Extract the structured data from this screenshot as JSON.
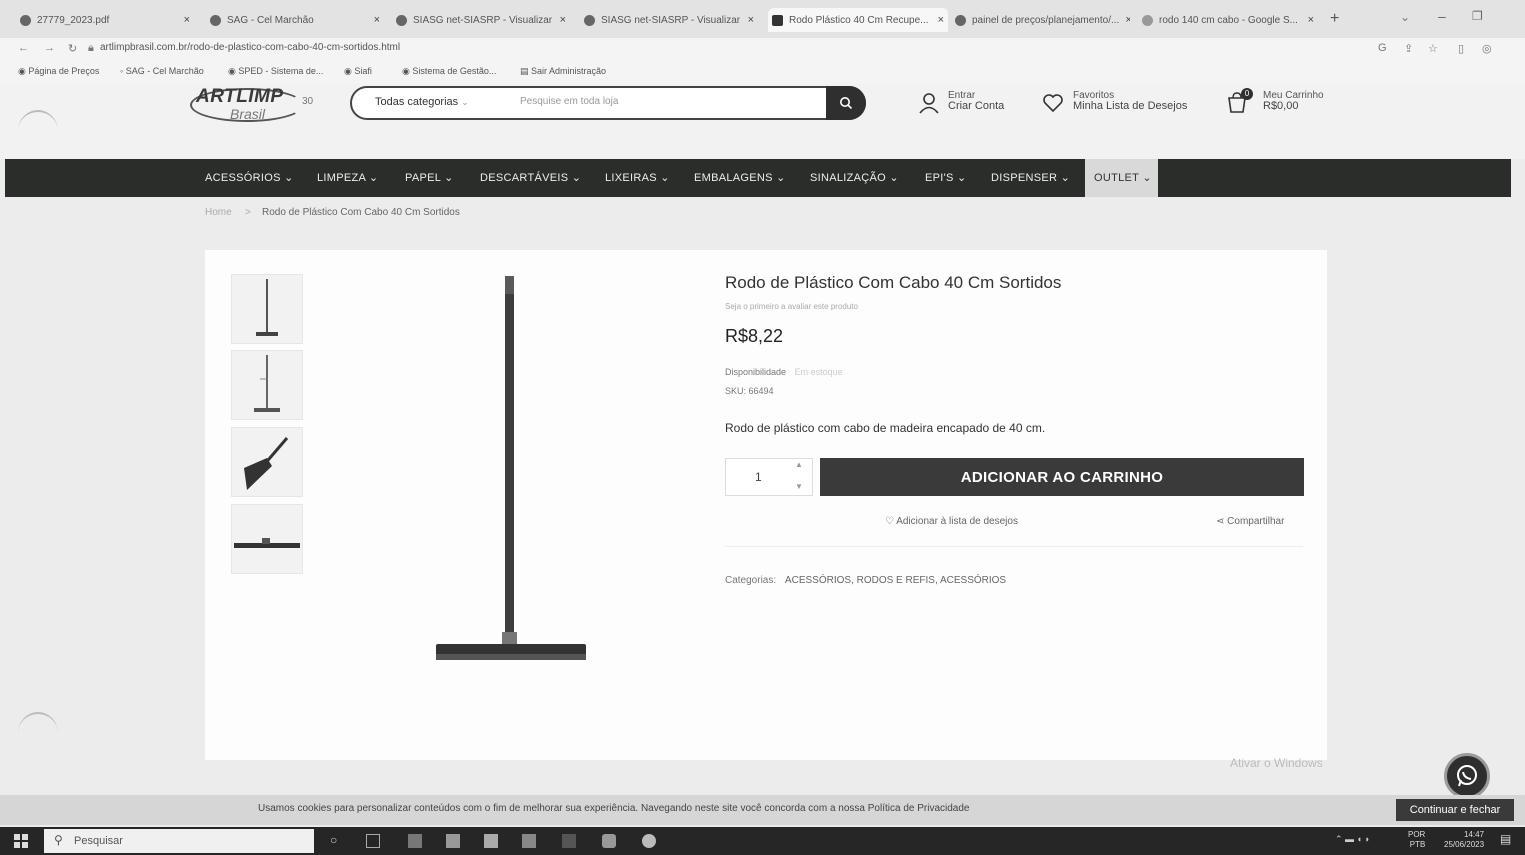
{
  "browser": {
    "tabs": [
      {
        "label": "27779_2023.pdf"
      },
      {
        "label": "SAG - Cel Marchão"
      },
      {
        "label": "SIASG net-SIASRP - Visualizar"
      },
      {
        "label": "SIASG net-SIASRP - Visualizar"
      },
      {
        "label": "Rodo Plástico 40 Cm Recupe..."
      },
      {
        "label": "painel de preços/planejamento/..."
      },
      {
        "label": "rodo 140 cm cabo - Google S..."
      }
    ],
    "url": "artlimpbrasil.com.br/rodo-de-plastico-com-cabo-40-cm-sortidos.html",
    "bookmarks": [
      "Página de Preços",
      "SAG - Cel Marchão",
      "SPED - Sistema de...",
      "Siafi",
      "Sistema de Gestão...",
      "Sair Administração"
    ]
  },
  "header": {
    "logo_text": "ARTLIMP",
    "logo_sub": "Brasil",
    "logo_badge": "30",
    "category_select": "Todas categorias",
    "search_placeholder": "Pesquise em toda loja",
    "account": {
      "line1": "Entrar",
      "line2": "Criar Conta"
    },
    "wishlist": {
      "line1": "Favoritos",
      "line2": "Minha Lista de Desejos"
    },
    "cart": {
      "line1": "Meu Carrinho",
      "line2": "R$0,00",
      "count": "0"
    }
  },
  "nav": {
    "items": [
      "ACESSÓRIOS ⌄",
      "LIMPEZA ⌄",
      "PAPEL ⌄",
      "DESCARTÁVEIS ⌄",
      "LIXEIRAS ⌄",
      "EMBALAGENS ⌄",
      "SINALIZAÇÃO ⌄",
      "EPI'S ⌄",
      "DISPENSER ⌄",
      "OUTLET ⌄"
    ]
  },
  "breadcrumb": {
    "home": "Home",
    "sep": ">",
    "current": "Rodo de Plástico Com Cabo 40 Cm Sortidos"
  },
  "product": {
    "title": "Rodo de Plástico Com Cabo 40 Cm Sortidos",
    "subtitle": "Seja o primeiro a avaliar este produto",
    "price": "R$8,22",
    "availability_label": "Disponibilidade",
    "availability_value": "Em estoque",
    "sku": "SKU: 66494",
    "description": "Rodo de plástico com cabo de madeira encapado de 40 cm.",
    "qty": "1",
    "add_to_cart": "ADICIONAR AO CARRINHO",
    "wishlist_link": "Adicionar à lista de desejos",
    "share_link": "Compartilhar",
    "categories_label": "Categorias:",
    "categories": "ACESSÓRIOS, RODOS E REFIS, ACESSÓRIOS"
  },
  "cookie": {
    "text": "Usamos cookies para personalizar conteúdos com o fim de melhorar sua experiência. Navegando neste site você concorda com a nossa Política de Privacidade",
    "button": "Continuar e fechar"
  },
  "watermark": "Ativar o Windows",
  "taskbar": {
    "search": "Pesquisar",
    "lang": "POR",
    "lang2": "PTB",
    "time": "14:47",
    "date": "25/06/2023"
  }
}
